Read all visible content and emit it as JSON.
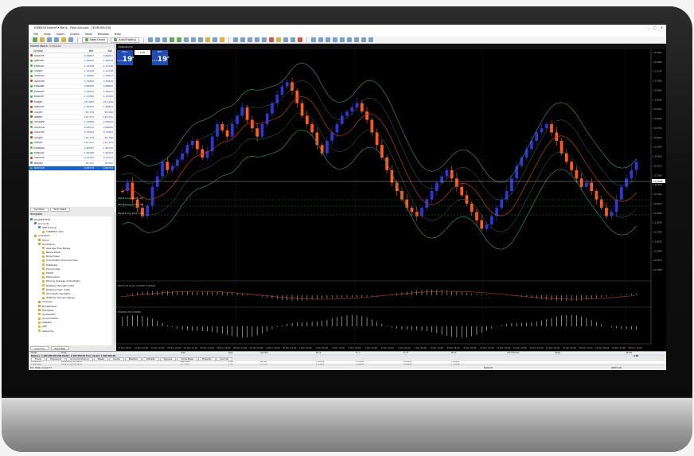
{
  "window": {
    "title": "1068326 DeathFX Bank - Real Account - [EURUSD,H4]",
    "buttons": [
      "_",
      "□",
      "✕"
    ]
  },
  "menu": [
    "File",
    "View",
    "Insert",
    "Charts",
    "Tools",
    "Window",
    "Help"
  ],
  "toolbar": {
    "new_order_label": "New Order",
    "autotrading_label": "AutoTrading"
  },
  "market_watch": {
    "title": "Market Watch: 17:01:24",
    "columns": [
      "Symbol",
      "Bid",
      "Ask"
    ],
    "rows": [
      {
        "symbol": "USDCHF",
        "bid": "0.99687",
        "ask": "0.99697",
        "color": "#c9362e"
      },
      {
        "symbol": "GBPUSD",
        "bid": "1.26605",
        "ask": "1.26619",
        "color": "#4caf50"
      },
      {
        "symbol": "EURUSD",
        "bid": "1.12748",
        "ask": "1.12748",
        "color": "#4caf50"
      },
      {
        "symbol": "USDJPY",
        "bid": "1.12148",
        "ask": "1.12148",
        "color": "#4caf50"
      },
      {
        "symbol": "USDCAD",
        "bid": "1.32865",
        "ask": "1.32872",
        "color": "#4caf50"
      },
      {
        "symbol": "AUDUSD",
        "bid": "0.72808",
        "ask": "0.72829",
        "color": "#c9362e"
      },
      {
        "symbol": "EURGBP",
        "bid": "0.88598",
        "ask": "0.88609",
        "color": "#4caf50"
      },
      {
        "symbol": "EURAUD",
        "bid": "1.52035",
        "ask": "1.55043",
        "color": "#4caf50"
      },
      {
        "symbol": "EURCHF",
        "bid": "1.11588",
        "ask": "1.11598",
        "color": "#4caf50"
      },
      {
        "symbol": "EURJPY",
        "bid": "127.883",
        "ask": "127.908",
        "color": "#c9362e"
      },
      {
        "symbol": "GBPCHF",
        "bid": "1.26805",
        "ask": "1.26834",
        "color": "#c9362e"
      },
      {
        "symbol": "CADJPY",
        "bid": "85.378",
        "ask": "85.389",
        "color": "#c9362e"
      },
      {
        "symbol": "GBPJPY",
        "bid": "143.372",
        "ask": "143.397",
        "color": "#c9362e"
      },
      {
        "symbol": "AUDNZD",
        "bid": "1.05588",
        "ask": "1.05606",
        "color": "#4caf50"
      },
      {
        "symbol": "AUDCAD",
        "bid": "0.96672",
        "ask": "0.96695",
        "color": "#4caf50"
      },
      {
        "symbol": "AUDCHF",
        "bid": "0.72563",
        "ask": "0.72583",
        "color": "#c9362e"
      },
      {
        "symbol": "AUDJPY",
        "bid": "82.775",
        "ask": "82.788",
        "color": "#c9362e"
      },
      {
        "symbol": "CHFJPY",
        "bid": "113.237",
        "ask": "113.254",
        "color": "#4caf50"
      },
      {
        "symbol": "EURNZD",
        "bid": "1.60587",
        "ask": "1.60730",
        "color": "#4caf50"
      },
      {
        "symbol": "EURCAD",
        "bid": "1.50088",
        "ask": "1.50103",
        "color": "#4caf50"
      },
      {
        "symbol": "CADCHF",
        "bid": "0.75782",
        "ask": "0.75773",
        "color": "#c9362e"
      },
      {
        "symbol": "NZDJPY",
        "bid": "78.197",
        "ask": "78.202",
        "color": "#4caf50"
      },
      {
        "symbol": "NZDUSD",
        "bid": "0.68749",
        "ask": "0.68764",
        "color": "#4caf50"
      }
    ],
    "tabs": [
      "Symbols",
      "Tick Chart"
    ]
  },
  "navigator": {
    "title": "Navigator",
    "items": [
      {
        "label": "DeathFX MT4",
        "indent": 0,
        "icon": "b"
      },
      {
        "label": "Accounts",
        "indent": 1,
        "icon": "b"
      },
      {
        "label": "968 Trading",
        "indent": 2,
        "icon": "b"
      },
      {
        "label": "1068326: Yam",
        "indent": 3,
        "icon": "y"
      },
      {
        "label": "Indicators",
        "indent": 1,
        "icon": "f"
      },
      {
        "label": "Trend",
        "indent": 2,
        "icon": "f"
      },
      {
        "label": "Oscillators",
        "indent": 2,
        "icon": "f"
      },
      {
        "label": "Average True Range",
        "indent": 3,
        "icon": "y"
      },
      {
        "label": "Bears Power",
        "indent": 3,
        "icon": "y"
      },
      {
        "label": "Bulls Power",
        "indent": 3,
        "icon": "y"
      },
      {
        "label": "Commodity Channel Index",
        "indent": 3,
        "icon": "y"
      },
      {
        "label": "DeMarker",
        "indent": 3,
        "icon": "y"
      },
      {
        "label": "Force Index",
        "indent": 3,
        "icon": "y"
      },
      {
        "label": "MACD",
        "indent": 3,
        "icon": "y"
      },
      {
        "label": "Momentum",
        "indent": 3,
        "icon": "y"
      },
      {
        "label": "Moving Average of Oscillator",
        "indent": 3,
        "icon": "y"
      },
      {
        "label": "Relative Strength Index",
        "indent": 3,
        "icon": "y"
      },
      {
        "label": "Relative Vigor Index",
        "indent": 3,
        "icon": "y"
      },
      {
        "label": "Stochastic Oscillator",
        "indent": 3,
        "icon": "y"
      },
      {
        "label": "Williams' Percent Range",
        "indent": 3,
        "icon": "y"
      },
      {
        "label": "Volumes",
        "indent": 2,
        "icon": "f"
      },
      {
        "label": "Bill Williams",
        "indent": 2,
        "icon": "f"
      },
      {
        "label": "Examples",
        "indent": 2,
        "icon": "f"
      },
      {
        "label": "Accelerator",
        "indent": 2,
        "icon": "y"
      },
      {
        "label": "Accumulation",
        "indent": 2,
        "icon": "y"
      },
      {
        "label": "Alligator",
        "indent": 2,
        "icon": "y"
      },
      {
        "label": "ATR",
        "indent": 2,
        "icon": "y"
      },
      {
        "label": "Awesome",
        "indent": 2,
        "icon": "y"
      }
    ],
    "tabs": [
      "Common",
      "Favorites"
    ]
  },
  "chart": {
    "tab_label": "EURUSD,H4",
    "one_click": {
      "sell_label": "SELL",
      "buy_label": "BUY",
      "lot": "1.00",
      "sell_price_small": "1.12",
      "sell_price_big": "19",
      "sell_price_sup": "6",
      "buy_price_small": "1.12",
      "buy_price_big": "19",
      "buy_price_sup": "8"
    },
    "order_labels": [
      "#0231 buy limit 1.00",
      "#0230 buy limit 1.00",
      "#0229 buy limit 1.00"
    ],
    "macd_label": "MACD(12,26,9) -0.00397 0.00094",
    "osc_label": "EURUSD,H4 0.00036",
    "price_axis": [
      "1.13450",
      "1.13360",
      "1.13270",
      "1.13180",
      "1.13090",
      "1.13000",
      "1.12910",
      "1.12820",
      "1.12730",
      "1.12640",
      "1.12550",
      "1.12460",
      "1.12370",
      "1.12280",
      "1.12190",
      "1.12100",
      "1.12010",
      "1.11920",
      "1.11830",
      "1.11740",
      "1.11650",
      "1.11560",
      "1.11470",
      "1.11380"
    ],
    "current_price": "1.12198",
    "time_axis": [
      "21 Nov 2016",
      "22 Nov 12:00",
      "23 Nov 04:00",
      "23 Nov 20:00",
      "24 Nov 12:00",
      "25 Nov 04:00",
      "25 Nov 20:00",
      "28 Nov 12:00",
      "29 Nov 04:00",
      "29 Nov 20:00",
      "30 Nov 12:00",
      "1 Dec 04:00",
      "1 Dec 20:00",
      "2 Dec 12:00",
      "5 Dec 04:00",
      "5 Dec 20:00",
      "6 Dec 12:00",
      "7 Dec 04:00",
      "7 Dec 20:00",
      "8 Dec 12:00",
      "9 Dec 04:00",
      "9 Dec 20:00",
      "12 Dec 12:00",
      "13 Dec 04:00",
      "13 Dec 20:00",
      "14 Dec 12:00",
      "15 Dec 04:00",
      "15 Dec 20:00",
      "16 Dec 12:00",
      "19 Dec 04:00",
      "19 Dec 20:00",
      "20 Dec 12:00"
    ],
    "up_color": "#2e36d6",
    "down_color": "#ff5a1f"
  },
  "terminal": {
    "columns": [
      "Order",
      "Time",
      "Type",
      "Size",
      "Symbol",
      "Price",
      "S / L",
      "T / P",
      "Price",
      "Commission",
      "Swap",
      "Profit"
    ],
    "balance_row": "Balance: 1 000 000.00 USD  Equity: 1 000 000.00  Free margin: 1 000 000.00",
    "balance_profit": "0.00",
    "rows": [
      [
        "11059230",
        "2016.12.05 07:46:08",
        "buy limit",
        "1.00",
        "eurusd",
        "1.12870",
        "0.00000",
        "0.00000",
        "1.12198",
        "",
        "",
        ""
      ],
      [
        "11059231",
        "2016.12.05 07:46:13",
        "buy limit",
        "1.00",
        "eurusd",
        "1.12840",
        "0.00000",
        "0.00000",
        "1.12198",
        "",
        "",
        ""
      ],
      [
        "11059232",
        "2016.12.05 07:46:17",
        "buy limit",
        "1.00",
        "eurusd",
        "1.12702",
        "0.00000",
        "0.00000",
        "1.12198",
        "",
        "",
        ""
      ]
    ],
    "tabs": [
      "Trade",
      "Exposure",
      "Account History",
      "News",
      "Alerts",
      "Mailbox",
      "Market",
      "Signals",
      "Code Base",
      "Experts",
      "Journal"
    ]
  },
  "status": {
    "help": "For Help, press F1",
    "profile": "Default",
    "traffic": "998/3 kb"
  }
}
